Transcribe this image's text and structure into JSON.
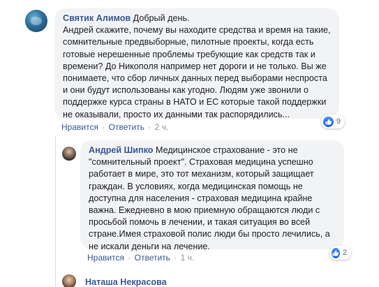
{
  "comments": [
    {
      "author": "Святик Алимов",
      "lines": [
        "Добрый день.",
        "Андрей скажите, почему вы находите средства и время на такие,",
        "сомнительные предвыборные, пилотные проекты, когда есть",
        "готовые нерешенные проблемы требующие как средств так и",
        "времени? До Никополя например нет дороги и не только. Вы же",
        "понимаете, что сбор личных данных перед выборами неспроста",
        "и они будут использованы как угодно. Людям уже звонили о",
        "поддержке курса страны в НАТО и ЕС которые такой поддержки",
        "не оказывали, просто их данными так распорядились..."
      ],
      "like_label": "Нравится",
      "reply_label": "Ответить",
      "separator": "·",
      "time": "2 ч.",
      "reaction_count": "9"
    },
    {
      "author": "Андрей Шипко",
      "lines": [
        "Медицинское страхование - это не",
        "\"сомнительный проект\". Страховая медицина успешно",
        "работает в мире, это тот механизм, который защищает",
        "граждан. В условиях, когда медицинская помощь не",
        "доступна для населения - страховая медицина крайне",
        "важна. Ежедневно в мою приемную обращаются люди с",
        "просьбой помочь в лечении, и такая ситуация во всей",
        "стране.Имея страховой полис люди бы просто лечились, а",
        "не искали деньги на лечение."
      ],
      "like_label": "Нравится",
      "reply_label": "Ответить",
      "separator": "·",
      "time": "1 ч.",
      "reaction_count": "2"
    }
  ],
  "next_comment": {
    "author": "Наташа Некрасова"
  },
  "colors": {
    "author": "#385898",
    "bubble": "#f2f3f5",
    "meta": "#90949c",
    "like_blue": "#1d60d8"
  }
}
